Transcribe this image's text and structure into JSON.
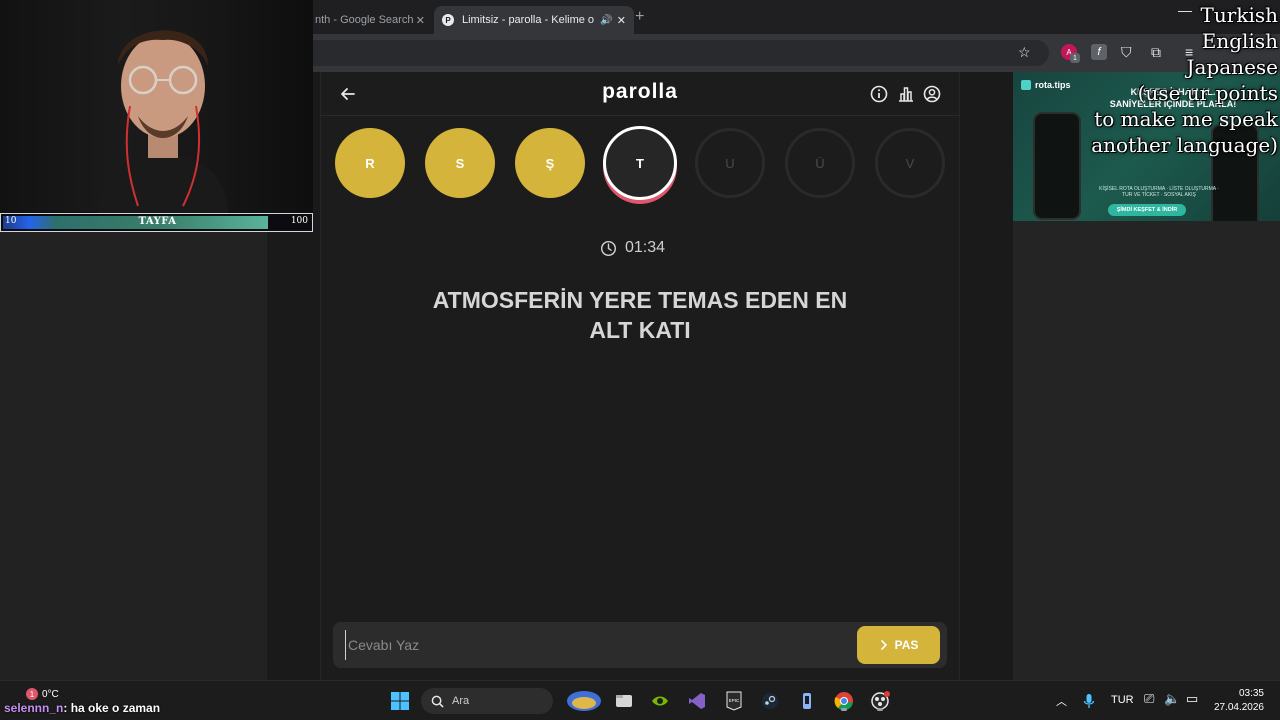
{
  "browser": {
    "tabs": [
      {
        "title": "nth - Google Search",
        "active": false
      },
      {
        "title": "Limitsiz - parolla - Kelime o",
        "active": true,
        "favicon": "P"
      }
    ]
  },
  "app": {
    "title": "parolla",
    "letters": [
      {
        "char": "R",
        "state": "done"
      },
      {
        "char": "S",
        "state": "done"
      },
      {
        "char": "Ş",
        "state": "done"
      },
      {
        "char": "T",
        "state": "current"
      },
      {
        "char": "U",
        "state": "pending"
      },
      {
        "char": "Ü",
        "state": "pending"
      },
      {
        "char": "V",
        "state": "pending"
      }
    ],
    "timer": "01:34",
    "question_line1": "ATMOSFERİN YERE TEMAS EDEN EN",
    "question_line2": "ALT KATI",
    "answer_placeholder": "Cevabı Yaz",
    "pass_label": "PAS",
    "accent_color": "#d4b43a"
  },
  "webcam": {
    "bar_min": "10",
    "bar_label": "TAYFA",
    "bar_max": "100"
  },
  "ad": {
    "brand": "rota.tips",
    "headline_1": "KEŞFET. İLHAM AL.",
    "headline_2": "SANİYELER İÇİNDE PLANLA!",
    "subtext": "KİŞİSEL ROTA OLUŞTURMA · LİSTE OLUŞTURMA · TUR VE TİCKET · SOSYAL AKIŞ",
    "cta": "ŞİMDİ KEŞFET & İNDİR"
  },
  "language_overlay": {
    "line1": "Turkish",
    "line2": "English",
    "line3": "Japanese",
    "line4": "(use ur points",
    "line5": "to make me speak",
    "line6": "another language)"
  },
  "taskbar": {
    "weather": "0°C",
    "weather_badge": "1",
    "chat_user": "selennn_n",
    "chat_message": ": ha oke o zaman",
    "search_placeholder": "Ara",
    "input_lang": "TUR",
    "time": "03:35",
    "date": "27.04.2026"
  }
}
